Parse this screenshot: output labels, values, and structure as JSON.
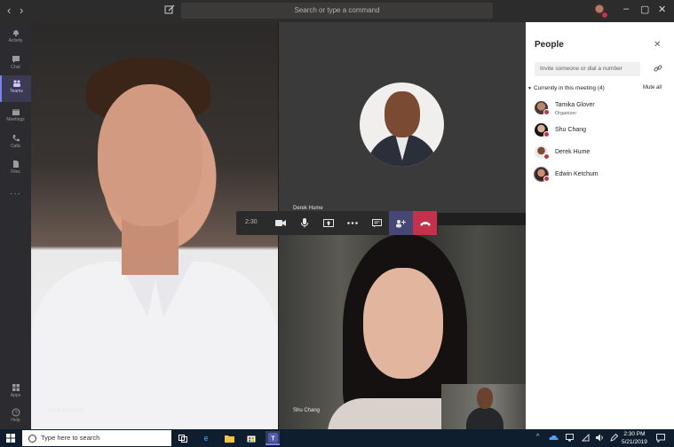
{
  "titlebar": {
    "back_glyph": "‹",
    "forward_glyph": "›",
    "search_placeholder": "Search or type a command",
    "minimize_glyph": "–",
    "maximize_glyph": "▢",
    "close_glyph": "✕"
  },
  "rail": {
    "items": [
      {
        "label": "Activity",
        "icon": "bell-icon"
      },
      {
        "label": "Chat",
        "icon": "chat-icon"
      },
      {
        "label": "Teams",
        "icon": "teams-icon",
        "active": true
      },
      {
        "label": "Meetings",
        "icon": "calendar-icon"
      },
      {
        "label": "Calls",
        "icon": "phone-icon"
      },
      {
        "label": "Files",
        "icon": "files-icon"
      }
    ],
    "more": "···",
    "bottom": [
      {
        "label": "Apps",
        "icon": "apps-icon"
      },
      {
        "label": "Help",
        "icon": "help-icon"
      }
    ]
  },
  "video": {
    "left_name": "Edwin Ketchum",
    "top_right_name": "Derek Hume",
    "bottom_right_name": "Shu Chang"
  },
  "callbar": {
    "time": "2:30",
    "buttons": [
      "video-icon",
      "mic-icon",
      "share-screen-icon",
      "more-icon",
      "chat-icon",
      "participants-icon",
      "hangup-icon"
    ]
  },
  "people": {
    "title": "People",
    "close": "✕",
    "invite_placeholder": "Invite someone or dial a number",
    "section_label": "Currently in this meeting (4)",
    "mute_all": "Mute all",
    "participants": [
      {
        "name": "Tamika Glover",
        "role": "Organizer"
      },
      {
        "name": "Shu Chang",
        "role": ""
      },
      {
        "name": "Derek Hume",
        "role": ""
      },
      {
        "name": "Edwin Ketchum",
        "role": ""
      }
    ]
  },
  "taskbar": {
    "search_placeholder": "Type here to search",
    "time": "2:30 PM",
    "date": "5/21/2019"
  },
  "colors": {
    "accent": "#6264a7",
    "hangup": "#c4314b",
    "status_busy": "#c4314b"
  }
}
